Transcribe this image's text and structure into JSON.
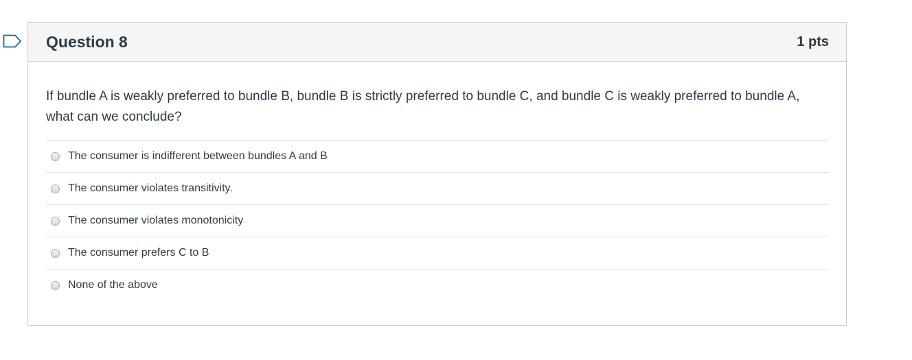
{
  "question": {
    "title": "Question 8",
    "points": "1 pts",
    "text": "If bundle A is weakly preferred to bundle B, bundle B is strictly preferred to bundle C, and bundle C is weakly preferred to bundle A, what can we conclude?",
    "answers": [
      {
        "label": "The consumer is indifferent between bundles A and B"
      },
      {
        "label": "The consumer violates transitivity."
      },
      {
        "label": "The consumer violates monotonicity"
      },
      {
        "label": "The consumer prefers C to B"
      },
      {
        "label": "None of the above"
      }
    ]
  },
  "icons": {
    "flag": "flag-question-icon",
    "radio": "radio-unchecked-icon"
  },
  "colors": {
    "text": "#2d3b45",
    "header_bg": "#f5f5f5",
    "border": "#c7cdd1",
    "flag_stroke": "#0770a3"
  }
}
